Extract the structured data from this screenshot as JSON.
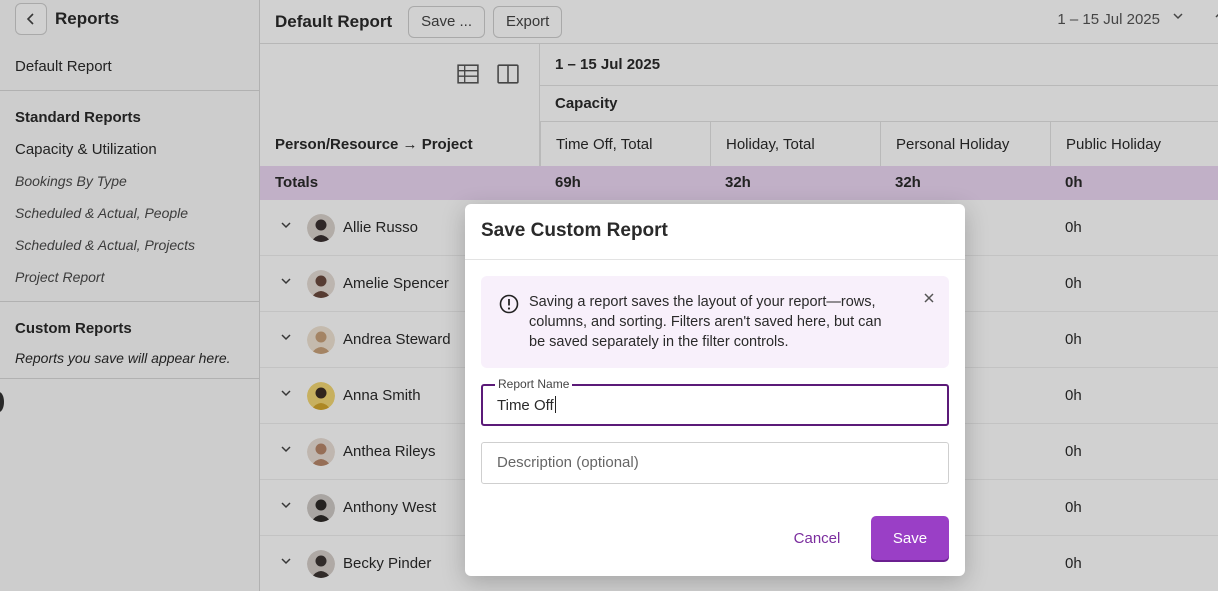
{
  "sidebar": {
    "back_icon": "chevron-left-icon",
    "title": "Reports",
    "default_report": "Default Report",
    "standard_section": "Standard Reports",
    "standard_items": [
      "Capacity & Utilization",
      "Bookings By Type",
      "Scheduled & Actual, People",
      "Scheduled & Actual, Projects",
      "Project Report"
    ],
    "custom_section": "Custom Reports",
    "custom_note": "Reports you save will appear here."
  },
  "toolbar": {
    "report_title": "Default Report",
    "save_label": "Save ...",
    "export_label": "Export",
    "date_range": "1 – 15 Jul 2025",
    "date_chevron_icon": "chevron-down-icon"
  },
  "table": {
    "view_icons": [
      "table-view-icon",
      "split-view-icon"
    ],
    "group_column": "Person/Resource → Project",
    "date_header": "1 – 15 Jul 2025",
    "group_header": "Capacity",
    "columns": [
      "Time Off, Total",
      "Holiday, Total",
      "Personal Holiday",
      "Public Holiday"
    ],
    "totals_label": "Totals",
    "totals": [
      "69h",
      "32h",
      "32h",
      "0h"
    ],
    "rows": [
      {
        "name": "Allie Russo",
        "public_holiday": "0h",
        "avatar_color": "#3a3030"
      },
      {
        "name": "Amelie Spencer",
        "public_holiday": "0h",
        "avatar_color": "#6b4a3e"
      },
      {
        "name": "Andrea Steward",
        "public_holiday": "0h",
        "avatar_color": "#c9a27a"
      },
      {
        "name": "Anna Smith",
        "public_holiday": "0h",
        "avatar_color": "#d4a72c"
      },
      {
        "name": "Anthea Rileys",
        "public_holiday": "0h",
        "avatar_color": "#b8876a"
      },
      {
        "name": "Anthony West",
        "public_holiday": "0h",
        "avatar_color": "#2e2a28"
      },
      {
        "name": "Becky Pinder",
        "public_holiday": "0h",
        "avatar_color": "#3c3533"
      }
    ]
  },
  "modal": {
    "title": "Save Custom Report",
    "info_icon": "info-circle-icon",
    "info_text": "Saving a report saves the layout of your report—rows, columns, and sorting. Filters aren't saved here, but can be saved separately in the filter controls.",
    "close_icon": "close-icon",
    "name_label": "Report Name",
    "name_value": "Time Off",
    "desc_placeholder": "Description (optional)",
    "cancel_label": "Cancel",
    "save_label": "Save"
  },
  "colors": {
    "accent": "#9a3fc6",
    "totals_bg": "#ecd7f3",
    "info_bg": "#f8f0fb"
  }
}
